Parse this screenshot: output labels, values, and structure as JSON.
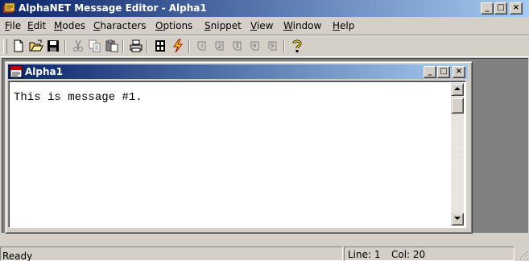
{
  "window": {
    "title": "AlphaNET Message Editor - Alpha1",
    "minimize": "_",
    "maximize": "□",
    "close": "×"
  },
  "menu": [
    {
      "label": "File",
      "u": "F",
      "rest": "ile"
    },
    {
      "label": "Edit",
      "u": "E",
      "rest": "dit"
    },
    {
      "label": "Modes",
      "u": "M",
      "rest": "odes"
    },
    {
      "label": "Characters",
      "u": "C",
      "rest": "haracters"
    },
    {
      "label": "Options",
      "u": "O",
      "rest": "ptions"
    },
    {
      "label": "Snippet",
      "u": "S",
      "rest": "nippet"
    },
    {
      "label": "View",
      "u": "V",
      "rest": "iew"
    },
    {
      "label": "Window",
      "u": "W",
      "rest": "indow"
    },
    {
      "label": "Help",
      "u": "H",
      "rest": "elp"
    }
  ],
  "toolbar": {
    "icons": [
      "new-document-icon",
      "open-folder-icon",
      "save-disk-icon",
      "cut-icon",
      "copy-icon",
      "paste-icon",
      "print-icon",
      "disconnect-icon",
      "send-lightning-icon",
      "snippet-1-icon",
      "snippet-2-icon",
      "snippet-3-icon",
      "snippet-4-icon",
      "snippet-5-icon",
      "help-question-icon"
    ]
  },
  "child": {
    "title": "Alpha1",
    "minimize": "_",
    "maximize": "□",
    "close": "×"
  },
  "editor": {
    "text": "This is message #1."
  },
  "status": {
    "ready": "Ready",
    "line": "Line: 1",
    "col": "Col: 20"
  },
  "colors": {
    "titlebar_start": "#0a246a",
    "titlebar_end": "#a6caf0",
    "face": "#d4d0c8",
    "workspace": "#808080"
  }
}
